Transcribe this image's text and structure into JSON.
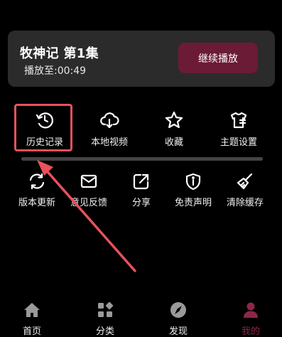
{
  "resume": {
    "title": "牧神记 第1集",
    "progress": "播放至:00:49",
    "button_label": "继续播放"
  },
  "menu": {
    "row1": [
      {
        "label": "历史记录",
        "icon": "history-icon"
      },
      {
        "label": "本地视频",
        "icon": "cloud-download-icon"
      },
      {
        "label": "收藏",
        "icon": "star-icon"
      },
      {
        "label": "主题设置",
        "icon": "shirt-icon"
      }
    ],
    "row2": [
      {
        "label": "版本更新",
        "icon": "refresh-icon"
      },
      {
        "label": "意见反馈",
        "icon": "mail-icon"
      },
      {
        "label": "分享",
        "icon": "share-icon"
      },
      {
        "label": "免责声明",
        "icon": "shield-icon"
      },
      {
        "label": "清除缓存",
        "icon": "broom-icon"
      }
    ]
  },
  "nav": {
    "items": [
      {
        "label": "首页",
        "icon": "home-icon"
      },
      {
        "label": "分类",
        "icon": "grid-icon"
      },
      {
        "label": "发现",
        "icon": "compass-icon"
      },
      {
        "label": "我的",
        "icon": "person-icon",
        "active": true
      }
    ]
  },
  "colors": {
    "accent": "#6b1b35",
    "active_nav": "#8e2647",
    "annotation": "#e7525b"
  }
}
